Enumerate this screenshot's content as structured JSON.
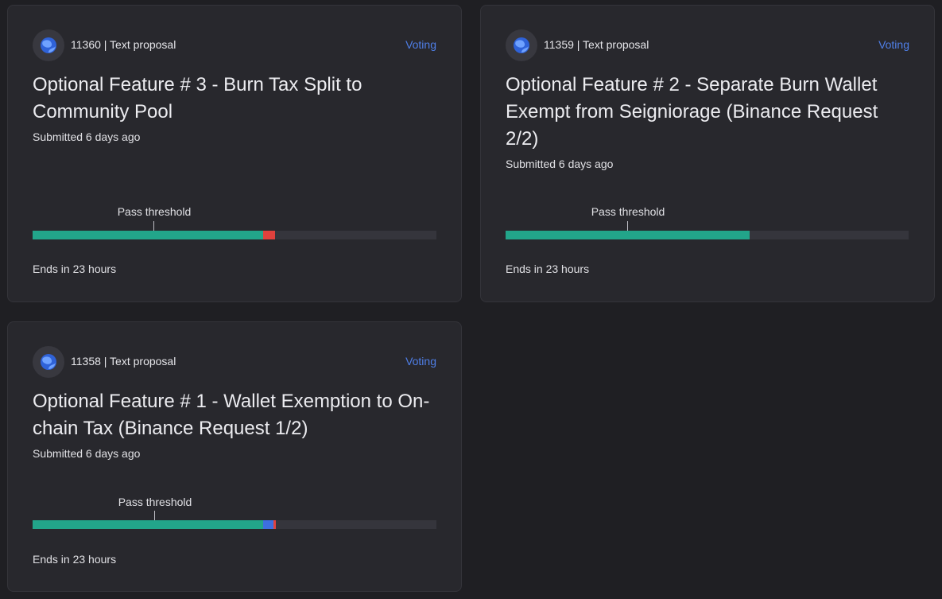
{
  "proposals": [
    {
      "meta": "11360 | Text proposal",
      "status": "Voting",
      "title": "Optional Feature # 3 - Burn Tax Split to Community Pool",
      "submitted": "Submitted 6 days ago",
      "threshold_label": "Pass threshold",
      "ends": "Ends in 23 hours",
      "votes": {
        "yes": 0.57,
        "abstain": 0.0,
        "no": 0.03
      },
      "threshold": 0.3
    },
    {
      "meta": "11359 | Text proposal",
      "status": "Voting",
      "title": "Optional Feature # 2 - Separate Burn Wallet Exempt from Seigniorage (Binance Request 2/2)",
      "submitted": "Submitted 6 days ago",
      "threshold_label": "Pass threshold",
      "ends": "Ends in 23 hours",
      "votes": {
        "yes": 0.605,
        "abstain": 0.0,
        "no": 0.0
      },
      "threshold": 0.3
    },
    {
      "meta": "11358 | Text proposal",
      "status": "Voting",
      "title": "Optional Feature # 1 - Wallet Exemption to On-chain Tax (Binance Request 1/2)",
      "submitted": "Submitted 6 days ago",
      "threshold_label": "Pass threshold",
      "ends": "Ends in 23 hours",
      "votes": {
        "yes": 0.571,
        "abstain": 0.026,
        "no": 0.006
      },
      "threshold": 0.3
    }
  ],
  "colors": {
    "yes": "#22a58a",
    "abstain": "#3d6fe0",
    "no": "#e0413d",
    "status": "#4f7fe8"
  },
  "icon": "terra-planet-icon"
}
